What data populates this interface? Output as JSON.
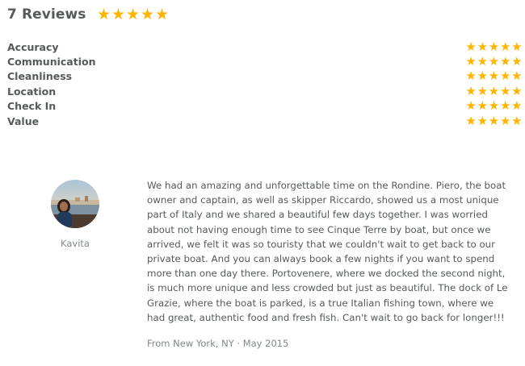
{
  "reviews_header": {
    "title": "7 Reviews",
    "overall_stars": 5
  },
  "categories": [
    {
      "label": "Accuracy",
      "stars": 5
    },
    {
      "label": "Communication",
      "stars": 5
    },
    {
      "label": "Cleanliness",
      "stars": 5
    },
    {
      "label": "Location",
      "stars": 5
    },
    {
      "label": "Check In",
      "stars": 5
    },
    {
      "label": "Value",
      "stars": 5
    }
  ],
  "review": {
    "author": "Kavita",
    "text": "We had an amazing and unforgettable time on the Rondine. Piero, the boat owner and captain, as well as skipper Riccardo, showed us a most unique part of Italy and we shared a beautiful few days together. I was worried about not having enough time to see Cinque Terre by boat, but once we arrived, we felt it was so touristy that we couldn't wait to get back to our private boat. And you can always book a few nights if you want to spend more than one day there. Portovenere, where we docked the second night, is much more unique and less crowded but just as beautiful. The dock of Le Grazie, where the boat is parked, is a true Italian fishing town, where we had great, authentic food and fresh fish. Can't wait to go back for longer!!!",
    "meta": "From New York, NY · May 2015"
  },
  "colors": {
    "star": "#ffb400",
    "text": "#565a5c",
    "muted": "#82888a"
  },
  "icons": {
    "star": "star-icon"
  }
}
